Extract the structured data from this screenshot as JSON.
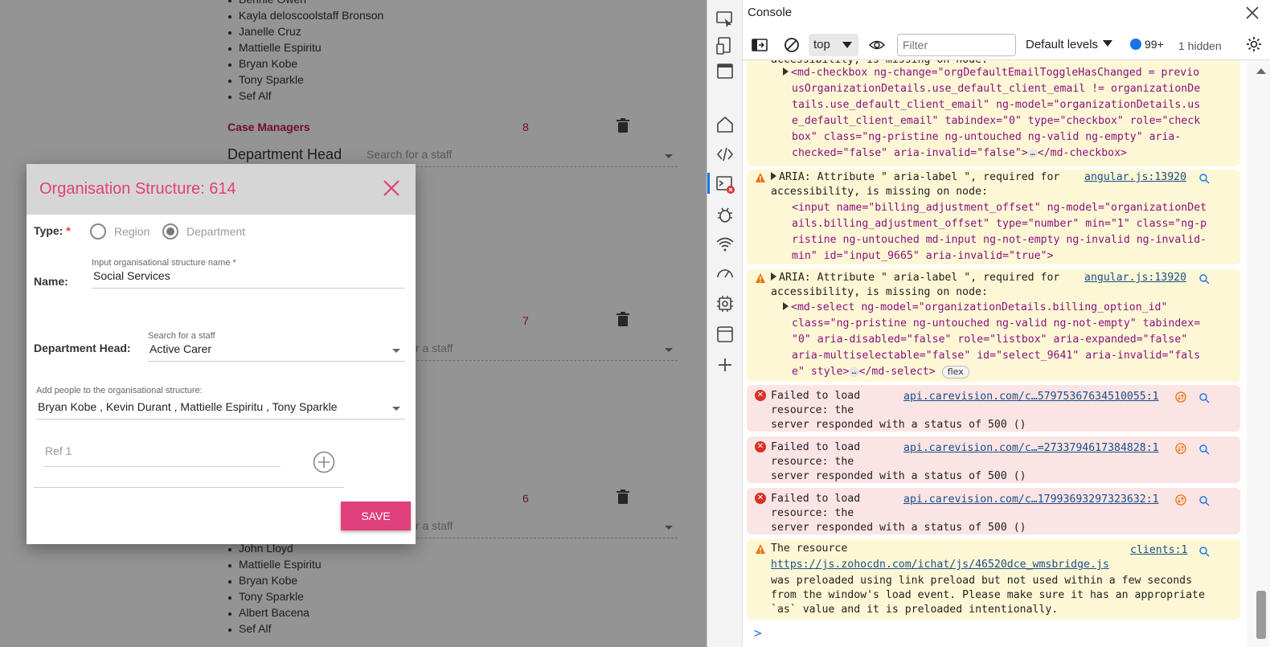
{
  "app": {
    "list_top": [
      "Bennie Owen",
      "Kayla deloscoolstaff Bronson",
      "Janelle Cruz",
      "Mattielle Espiritu",
      "Bryan Kobe",
      "Tony Sparkle",
      "Sef Alf"
    ],
    "section_title": "Case Managers",
    "section_count": "8",
    "department_head_label": "Department Head",
    "search_placeholder": "Search for a staff",
    "search_placeholder_partial": "r a staff",
    "count_2": "7",
    "count_3": "6",
    "list_bottom": [
      "John Lloyd",
      "Mattielle Espiritu",
      "Bryan Kobe",
      "Tony Sparkle",
      "Albert Bacena",
      "Sef Alf"
    ]
  },
  "modal": {
    "title": "Organisation Structure: 614",
    "type_label": "Type:",
    "type_required": "*",
    "radio_region": "Region",
    "radio_department": "Department",
    "selected_type": "Department",
    "name_label": "Name:",
    "name_field_label": "Input organisational structure name *",
    "name_value": "Social Services",
    "dept_head_label": "Department Head:",
    "dept_head_field_label": "Search for a staff",
    "dept_head_value": "Active Carer",
    "people_label": "Add people to the organisational structure:",
    "people_value": "Bryan Kobe , Kevin Durant , Mattielle Espiritu , Tony Sparkle",
    "ref_placeholder": "Ref 1",
    "save_label": "SAVE"
  },
  "devtools": {
    "title": "Console",
    "context": "top",
    "filter_placeholder": "Filter",
    "levels": "Default levels",
    "issues_count": "99+",
    "hidden_count": "1 hidden",
    "messages": {
      "m0_head": "accessibility, is missing on node:",
      "m0_code": [
        "<md-checkbox ng-change=\"orgDefaultEmailToggleHasChanged = previo",
        "usOrganizationDetails.use_default_client_email != organizationDe",
        "tails.use_default_client_email\" ng-model=\"organizationDetails.us",
        "e_default_client_email\" tabindex=\"0\" type=\"checkbox\" role=\"check",
        "box\" class=\"ng-pristine ng-untouched ng-valid ng-empty\" aria-",
        "checked=\"false\" aria-invalid=\"false\">",
        "</md-checkbox>"
      ],
      "m1_head": "ARIA: Attribute \" aria-label \", required for",
      "m1_head2": "accessibility, is missing on node:",
      "m1_link": "angular.js:13920",
      "m1_code": [
        "<input name=\"billing_adjustment_offset\" ng-model=\"organizationDet",
        "ails.billing_adjustment_offset\" type=\"number\" min=\"1\" class=\"ng-p",
        "ristine ng-untouched md-input ng-not-empty ng-invalid ng-invalid-",
        "min\" id=\"input_9665\" aria-invalid=\"true\">"
      ],
      "m2_head": "ARIA: Attribute \" aria-label \", required for",
      "m2_head2": "accessibility, is missing on node:",
      "m2_link": "angular.js:13920",
      "m2_code": [
        "<md-select ng-model=\"organizationDetails.billing_option_id\"",
        "class=\"ng-pristine ng-untouched ng-valid ng-not-empty\" tabindex=",
        "\"0\" aria-disabled=\"false\" role=\"listbox\" aria-expanded=\"false\"",
        "aria-multiselectable=\"false\" id=\"select_9641\" aria-invalid=\"fals",
        "e\" style>",
        "</md-select>"
      ],
      "m2_pill": "flex",
      "err_l1": "Failed to load",
      "err_l2": "resource: the",
      "err_l3": "server responded with a status of 500 ()",
      "e1_link": "api.carevision.com/c…57975367634510055:1",
      "e2_link": "api.carevision.com/c…=2733794617384828:1",
      "e3_link": "api.carevision.com/c…17993693297323632:1",
      "m6_head": "The resource",
      "m6_link": "clients:1",
      "m6_url": "https://js.zohocdn.com/ichat/js/46520dce_wmsbridge.js",
      "m6_l3": "was preloaded using link preload but not used within a few seconds",
      "m6_l4": "from the window's load event. Please make sure it has an appropriate",
      "m6_l5": "`as` value and it is preloaded intentionally."
    },
    "prompt": ">"
  }
}
